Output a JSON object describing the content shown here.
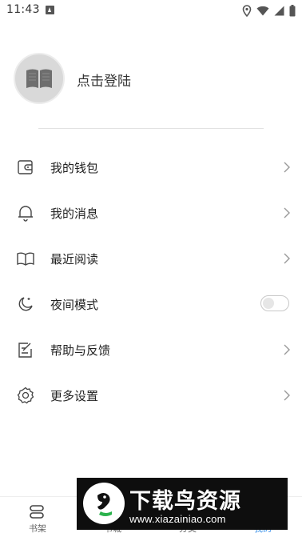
{
  "status_bar": {
    "time": "11:43"
  },
  "profile": {
    "login_label": "点击登陆"
  },
  "menu": [
    {
      "label": "我的钱包",
      "icon": "wallet-icon"
    },
    {
      "label": "我的消息",
      "icon": "bell-icon"
    },
    {
      "label": "最近阅读",
      "icon": "open-book-icon"
    },
    {
      "label": "夜间模式",
      "icon": "moon-icon",
      "toggle_on": false
    },
    {
      "label": "帮助与反馈",
      "icon": "feedback-icon"
    },
    {
      "label": "更多设置",
      "icon": "gear-icon"
    }
  ],
  "tabbar": {
    "tabs": [
      {
        "label": "书架",
        "icon": "bookshelf-icon",
        "active": false
      },
      {
        "label": "书城",
        "icon": "bookstore-icon",
        "active": false
      },
      {
        "label": "分类",
        "icon": "category-icon",
        "active": false
      },
      {
        "label": "我的",
        "icon": "user-icon",
        "active": true
      }
    ]
  },
  "watermark": {
    "title": "下载鸟资源",
    "url": "www.xiazainiao.com"
  },
  "colors": {
    "accent": "#3a8ee6",
    "avatar_bg": "#d9d9d9",
    "text": "#222222"
  }
}
